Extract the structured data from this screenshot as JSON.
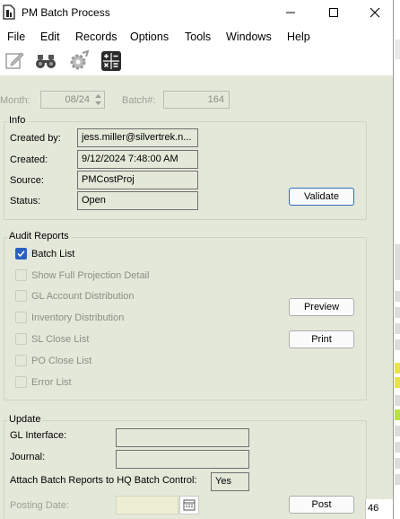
{
  "window": {
    "title": "PM Batch Process",
    "controls": [
      "minimize",
      "maximize",
      "close"
    ]
  },
  "menu": [
    "File",
    "Edit",
    "Records",
    "Options",
    "Tools",
    "Windows",
    "Help"
  ],
  "toolbar": [
    "edit-icon",
    "binoculars-icon",
    "gear-icon",
    "calculator-icon"
  ],
  "header": {
    "month_label": "Month:",
    "month_value": "08/24",
    "batch_label": "Batch#:",
    "batch_value": "164"
  },
  "info": {
    "title": "Info",
    "created_by_label": "Created by:",
    "created_by_value": "jess.miller@silvertrek.n...",
    "created_label": "Created:",
    "created_value": "9/12/2024 7:48:00 AM",
    "source_label": "Source:",
    "source_value": "PMCostProj",
    "status_label": "Status:",
    "status_value": "Open",
    "validate_button": "Validate"
  },
  "audit": {
    "title": "Audit Reports",
    "options": [
      {
        "label": "Batch List",
        "checked": true,
        "enabled": true
      },
      {
        "label": "Show Full Projection Detail",
        "checked": false,
        "enabled": false
      },
      {
        "label": "GL Account Distribution",
        "checked": false,
        "enabled": false
      },
      {
        "label": "Inventory Distribution",
        "checked": false,
        "enabled": false
      },
      {
        "label": "SL Close List",
        "checked": false,
        "enabled": false
      },
      {
        "label": "PO Close List",
        "checked": false,
        "enabled": false
      },
      {
        "label": "Error List",
        "checked": false,
        "enabled": false
      }
    ],
    "preview_button": "Preview",
    "print_button": "Print"
  },
  "update": {
    "title": "Update",
    "gl_interface_label": "GL Interface:",
    "gl_interface_value": "",
    "journal_label": "Journal:",
    "journal_value": "",
    "attach_label": "Attach Batch Reports to HQ Batch Control:",
    "attach_value": "Yes",
    "posting_date_label": "Posting Date:",
    "posting_date_value": "",
    "post_button": "Post"
  },
  "status_fragment": "46",
  "colors": {
    "form_bg": "#e4e8d9",
    "accent": "#2a61c1"
  }
}
